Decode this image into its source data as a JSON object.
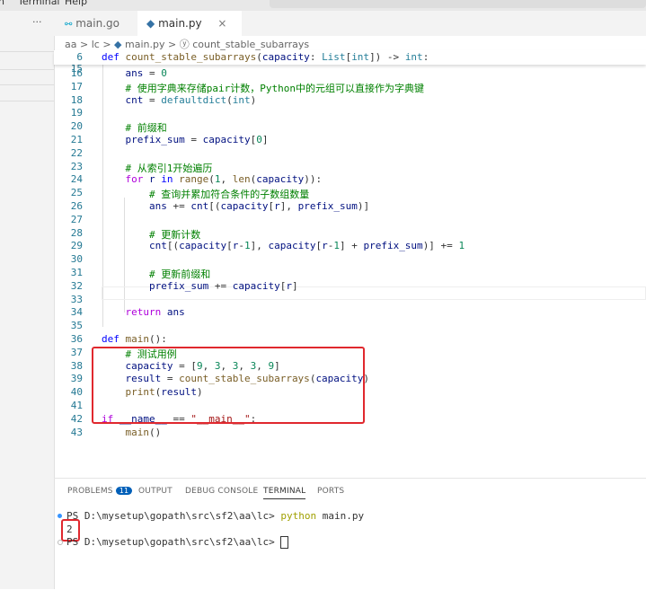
{
  "menu": {
    "items": [
      "n",
      "Terminal",
      "Help"
    ]
  },
  "tabs": [
    {
      "label": "main.go",
      "icon": "go-icon"
    },
    {
      "label": "main.py",
      "icon": "python-icon",
      "close": "×"
    }
  ],
  "sidebar": {
    "more": "···"
  },
  "breadcrumb": {
    "items": [
      "aa",
      ">",
      "lc",
      ">",
      "main.py",
      ">",
      "count_stable_subarrays"
    ]
  },
  "sticky": {
    "num": "6",
    "tokens": [
      [
        "def ",
        "kw"
      ],
      [
        "count_stable_subarrays",
        "fn"
      ],
      [
        "(",
        "pl"
      ],
      [
        "capacity",
        "vr"
      ],
      [
        ": ",
        "pl"
      ],
      [
        "List",
        "ty"
      ],
      [
        "[",
        "pl"
      ],
      [
        "int",
        "ty"
      ],
      [
        "]) -> ",
        "pl"
      ],
      [
        "int",
        "ty"
      ],
      [
        ":",
        "pl"
      ]
    ]
  },
  "code": [
    {
      "n": "15",
      "t": []
    },
    {
      "n": "16",
      "t": [
        [
          "    ans",
          "vr"
        ],
        [
          " = ",
          "pl"
        ],
        [
          "0",
          "nm"
        ]
      ]
    },
    {
      "n": "17",
      "t": [
        [
          "    # 使用字典来存储pair计数，Python中的元组可以直接作为字典键",
          "cm"
        ]
      ]
    },
    {
      "n": "18",
      "t": [
        [
          "    cnt",
          "vr"
        ],
        [
          " = ",
          "pl"
        ],
        [
          "defaultdict",
          "ty"
        ],
        [
          "(",
          "pl"
        ],
        [
          "int",
          "ty"
        ],
        [
          ")",
          "pl"
        ]
      ]
    },
    {
      "n": "19",
      "t": []
    },
    {
      "n": "20",
      "t": [
        [
          "    # 前缀和",
          "cm"
        ]
      ]
    },
    {
      "n": "21",
      "t": [
        [
          "    prefix_sum",
          "vr"
        ],
        [
          " = ",
          "pl"
        ],
        [
          "capacity",
          "vr"
        ],
        [
          "[",
          "pl"
        ],
        [
          "0",
          "nm"
        ],
        [
          "]",
          "pl"
        ]
      ]
    },
    {
      "n": "22",
      "t": []
    },
    {
      "n": "23",
      "t": [
        [
          "    # 从索引1开始遍历",
          "cm"
        ]
      ]
    },
    {
      "n": "24",
      "t": [
        [
          "    for ",
          "kw2"
        ],
        [
          "r",
          "vr"
        ],
        [
          " in ",
          "kw"
        ],
        [
          "range",
          "fn"
        ],
        [
          "(",
          "pl"
        ],
        [
          "1",
          "nm"
        ],
        [
          ", ",
          "pl"
        ],
        [
          "len",
          "fn"
        ],
        [
          "(",
          "pl"
        ],
        [
          "capacity",
          "vr"
        ],
        [
          ")):",
          "pl"
        ]
      ]
    },
    {
      "n": "25",
      "t": [
        [
          "        # 查询并累加符合条件的子数组数量",
          "cm"
        ]
      ]
    },
    {
      "n": "26",
      "t": [
        [
          "        ans",
          "vr"
        ],
        [
          " += ",
          "pl"
        ],
        [
          "cnt",
          "vr"
        ],
        [
          "[(",
          "pl"
        ],
        [
          "capacity",
          "vr"
        ],
        [
          "[",
          "pl"
        ],
        [
          "r",
          "vr"
        ],
        [
          "], ",
          "pl"
        ],
        [
          "prefix_sum",
          "vr"
        ],
        [
          ")]",
          "pl"
        ]
      ]
    },
    {
      "n": "27",
      "t": []
    },
    {
      "n": "28",
      "t": [
        [
          "        # 更新计数",
          "cm"
        ]
      ]
    },
    {
      "n": "29",
      "t": [
        [
          "        cnt",
          "vr"
        ],
        [
          "[(",
          "pl"
        ],
        [
          "capacity",
          "vr"
        ],
        [
          "[",
          "pl"
        ],
        [
          "r",
          "vr"
        ],
        [
          "-",
          "pl"
        ],
        [
          "1",
          "nm"
        ],
        [
          "], ",
          "pl"
        ],
        [
          "capacity",
          "vr"
        ],
        [
          "[",
          "pl"
        ],
        [
          "r",
          "vr"
        ],
        [
          "-",
          "pl"
        ],
        [
          "1",
          "nm"
        ],
        [
          "] + ",
          "pl"
        ],
        [
          "prefix_sum",
          "vr"
        ],
        [
          ")] += ",
          "pl"
        ],
        [
          "1",
          "nm"
        ]
      ]
    },
    {
      "n": "30",
      "t": []
    },
    {
      "n": "31",
      "t": [
        [
          "        # 更新前缀和",
          "cm"
        ]
      ]
    },
    {
      "n": "32",
      "t": [
        [
          "        prefix_sum",
          "vr"
        ],
        [
          " += ",
          "pl"
        ],
        [
          "capacity",
          "vr"
        ],
        [
          "[",
          "pl"
        ],
        [
          "r",
          "vr"
        ],
        [
          "]",
          "pl"
        ]
      ]
    },
    {
      "n": "33",
      "t": []
    },
    {
      "n": "34",
      "t": [
        [
          "    return ",
          "kw2"
        ],
        [
          "ans",
          "vr"
        ]
      ]
    },
    {
      "n": "35",
      "t": []
    },
    {
      "n": "36",
      "t": [
        [
          "def ",
          "kw"
        ],
        [
          "main",
          "fn"
        ],
        [
          "():",
          "pl"
        ]
      ]
    },
    {
      "n": "37",
      "t": [
        [
          "    # 测试用例",
          "cm"
        ]
      ]
    },
    {
      "n": "38",
      "t": [
        [
          "    capacity",
          "vr"
        ],
        [
          " = [",
          "pl"
        ],
        [
          "9",
          "nm"
        ],
        [
          ", ",
          "pl"
        ],
        [
          "3",
          "nm"
        ],
        [
          ", ",
          "pl"
        ],
        [
          "3",
          "nm"
        ],
        [
          ", ",
          "pl"
        ],
        [
          "3",
          "nm"
        ],
        [
          ", ",
          "pl"
        ],
        [
          "9",
          "nm"
        ],
        [
          "]",
          "pl"
        ]
      ]
    },
    {
      "n": "39",
      "t": [
        [
          "    result",
          "vr"
        ],
        [
          " = ",
          "pl"
        ],
        [
          "count_stable_subarrays",
          "fn"
        ],
        [
          "(",
          "pl"
        ],
        [
          "capacity",
          "vr"
        ],
        [
          ")",
          "pl"
        ]
      ]
    },
    {
      "n": "40",
      "t": [
        [
          "    print",
          "fn"
        ],
        [
          "(",
          "pl"
        ],
        [
          "result",
          "vr"
        ],
        [
          ")",
          "pl"
        ]
      ]
    },
    {
      "n": "41",
      "t": []
    },
    {
      "n": "42",
      "t": [
        [
          "if ",
          "kw2"
        ],
        [
          "__name__",
          "vr"
        ],
        [
          " == ",
          "pl"
        ],
        [
          "\"__main__\"",
          "st"
        ],
        [
          ":",
          "pl"
        ]
      ]
    },
    {
      "n": "43",
      "t": [
        [
          "    main",
          "fn"
        ],
        [
          "()",
          "pl"
        ]
      ]
    }
  ],
  "panel": {
    "tabs": [
      "PROBLEMS",
      "OUTPUT",
      "DEBUG CONSOLE",
      "TERMINAL",
      "PORTS"
    ],
    "problems_count": "11",
    "active": "TERMINAL"
  },
  "terminal": {
    "prompt": "PS D:\\mysetup\\gopath\\src\\sf2\\aa\\lc> ",
    "command": "python",
    "args": " main.py",
    "output": "2",
    "prompt2": "PS D:\\mysetup\\gopath\\src\\sf2\\aa\\lc> "
  }
}
